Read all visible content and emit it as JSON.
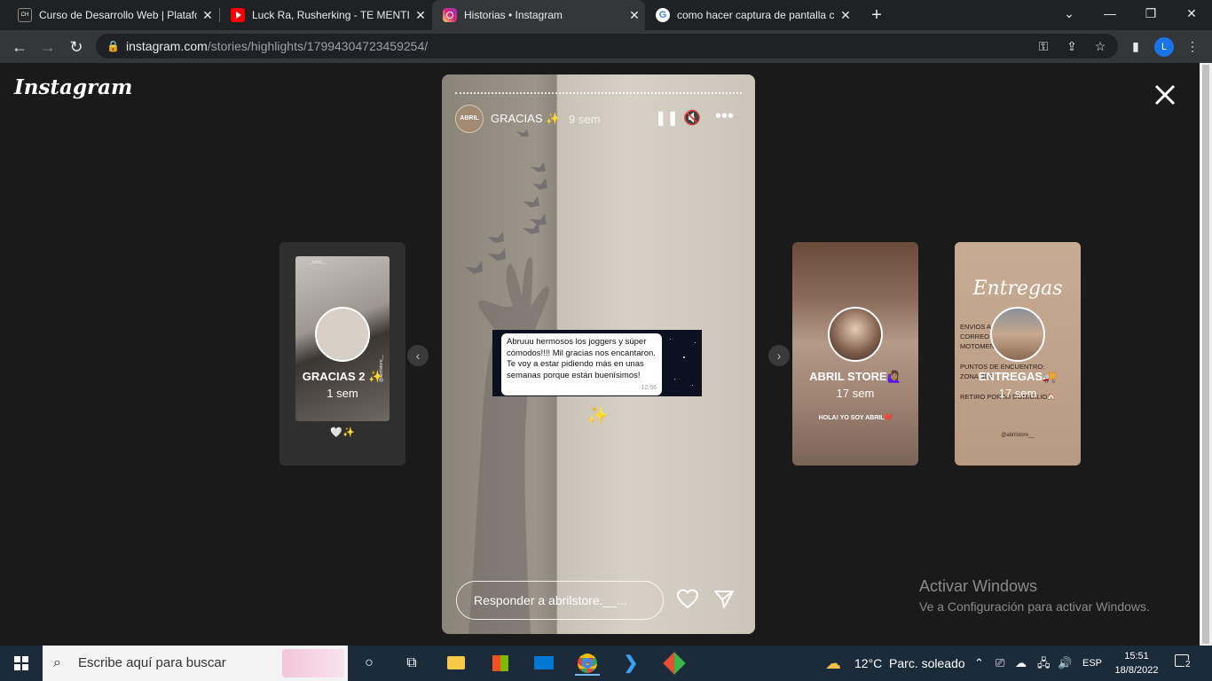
{
  "browser": {
    "tabs": [
      {
        "title": "Curso de Desarrollo Web | Platafo",
        "favicon": "coder-icon",
        "active": false
      },
      {
        "title": "Luck Ra, Rusherking - TE MENTIR",
        "favicon": "youtube-icon",
        "active": false
      },
      {
        "title": "Historias • Instagram",
        "favicon": "instagram-icon",
        "active": true
      },
      {
        "title": "como hacer captura de pantalla c",
        "favicon": "google-icon",
        "active": false
      }
    ],
    "url_host": "instagram.com",
    "url_path": "/stories/highlights/17994304723459254/",
    "profile_initial": "L"
  },
  "instagram": {
    "logo": "Instagram",
    "story": {
      "username": "GRACIAS ✨",
      "avatar_text": "ABRIL",
      "time": "9 sem",
      "message": "Abruuu hermosos los joggers y súper cómodos!!!! Mil gracias nos encantaron. Te voy a estar pidiendo más en unas semanas porque están buenísimos!",
      "message_time": "12:56",
      "sparkle": "✨",
      "reply_placeholder": "Responder a abrilstore.__..."
    },
    "prev_card": {
      "name": "GRACIAS 2 ✨",
      "ago": "1 sem",
      "caption": "🤍✨",
      "inner_user": "_carol__",
      "watermark": "@abrilstore__"
    },
    "next_cards": [
      {
        "name": "ABRIL STORE🙋🏽‍♀️",
        "ago": "17 sem",
        "caption": "HOLA! YO SOY ABRIL❤️"
      },
      {
        "name": "ENTREGAS🚚",
        "ago": "17 sem",
        "script_title": "Entregas",
        "lines": [
          "ENVIOS A TODO EL PAIS:",
          "CORREO ARGENTINO o",
          "MOTOMENSAJERIA 🛵",
          "PUNTOS DE ENCUENTRO:",
          "ZONA SUR",
          "RETIRO POR MI DOMICILIO🏠"
        ],
        "handle": "@abrilstore__"
      }
    ]
  },
  "watermark": {
    "line1": "Activar Windows",
    "line2": "Ve a Configuración para activar Windows."
  },
  "taskbar": {
    "search_placeholder": "Escribe aquí para buscar",
    "weather": "12°C  Parc. soleado",
    "lang": "ESP",
    "time": "15:51",
    "date": "18/8/2022",
    "notifications": "2"
  }
}
